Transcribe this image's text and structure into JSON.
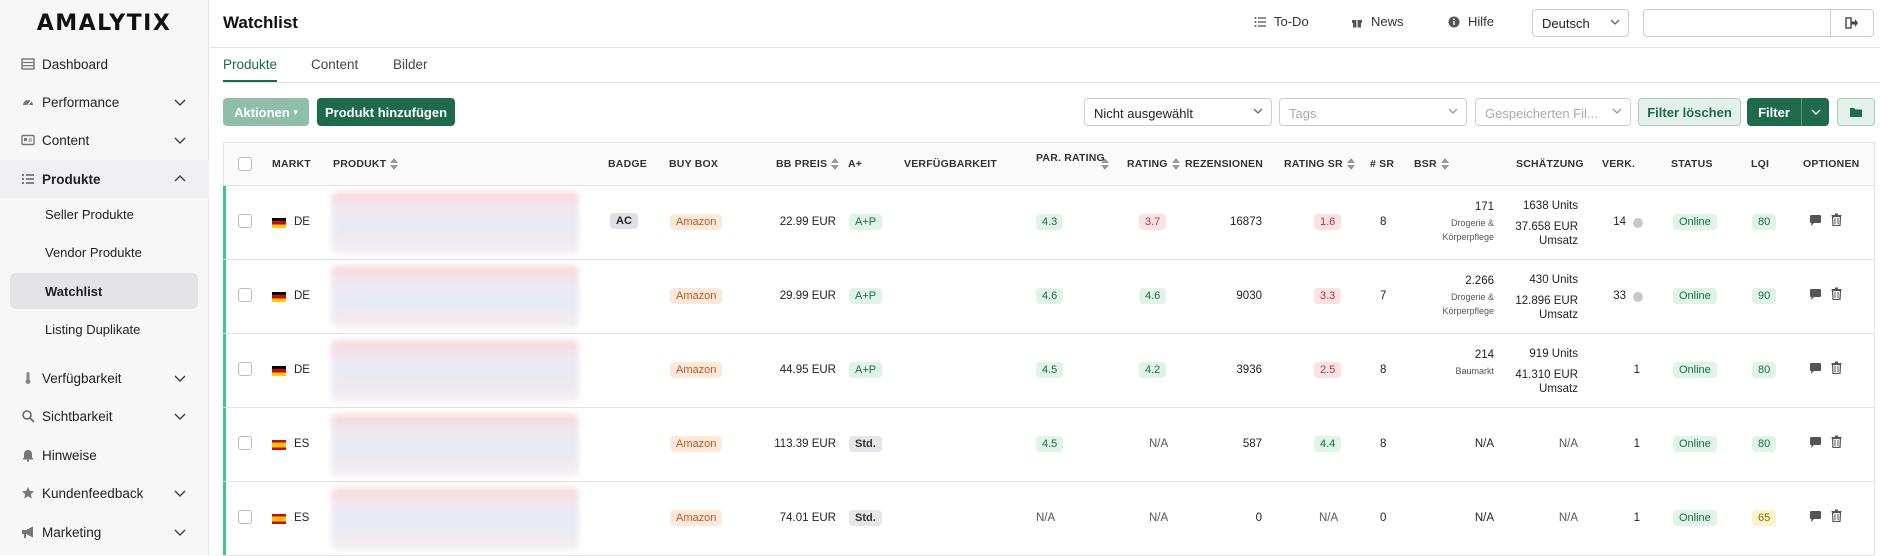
{
  "brand": {
    "logo": "AMALYTIX"
  },
  "sidebar": {
    "items": [
      {
        "label": "Dashboard",
        "icon": "table-icon",
        "chevron": false
      },
      {
        "label": "Performance",
        "icon": "gauge-icon",
        "chevron": true
      },
      {
        "label": "Content",
        "icon": "card-icon",
        "chevron": true
      },
      {
        "label": "Produkte",
        "icon": "list-icon",
        "chevron": true,
        "open": true
      },
      {
        "label": "Verfügbarkeit",
        "icon": "thermometer-icon",
        "chevron": true
      },
      {
        "label": "Sichtbarkeit",
        "icon": "search-icon",
        "chevron": true
      },
      {
        "label": "Hinweise",
        "icon": "bell-icon",
        "chevron": false
      },
      {
        "label": "Kundenfeedback",
        "icon": "star-icon",
        "chevron": true
      },
      {
        "label": "Marketing",
        "icon": "megaphone-icon",
        "chevron": true
      }
    ],
    "subitems": [
      {
        "label": "Seller Produkte",
        "active": false
      },
      {
        "label": "Vendor Produkte",
        "active": false
      },
      {
        "label": "Watchlist",
        "active": true
      },
      {
        "label": "Listing Duplikate",
        "active": false
      }
    ]
  },
  "header": {
    "title": "Watchlist",
    "todo": "To-Do",
    "news": "News",
    "help": "Hilfe",
    "language": "Deutsch",
    "search_value": ""
  },
  "tabs": [
    "Produkte",
    "Content",
    "Bilder"
  ],
  "toolbar": {
    "actions": "Aktionen",
    "add_product": "Produkt hinzufügen",
    "select1": "Nicht ausgewählt",
    "tags_placeholder": "Tags",
    "saved_filters_placeholder": "Gespeicherten Fil...",
    "clear_filter": "Filter löschen",
    "filter": "Filter"
  },
  "table": {
    "columns": [
      "MARKT",
      "PRODUKT",
      "BADGE",
      "BUY BOX",
      "BB PREIS",
      "A+",
      "VERFÜGBARKEIT",
      "PAR. RATING",
      "RATING",
      "REZENSIONEN",
      "RATING SR",
      "# SR",
      "BSR",
      "SCHÄTZUNG",
      "VERK.",
      "STATUS",
      "LQI",
      "OPTIONEN"
    ],
    "rows": [
      {
        "market": "DE",
        "badge": "AC",
        "buybox": "Amazon",
        "price": "22.99 EUR",
        "aplus": "A+P",
        "par_rating": "4.3",
        "rating": "3.7",
        "rating_color": "red",
        "reviews": "16873",
        "rating_sr": "1.6",
        "rating_sr_color": "red",
        "sr": "8",
        "bsr": "171",
        "bsr_cat1": "Drogerie &",
        "bsr_cat2": "Körperpflege",
        "est_units": "1638 Units",
        "est_rev1": "37.658 EUR",
        "est_rev2": "Umsatz",
        "verk": "14",
        "verk_info": true,
        "status": "Online",
        "lqi": "80",
        "lqi_color": "green"
      },
      {
        "market": "DE",
        "badge": "",
        "buybox": "Amazon",
        "price": "29.99 EUR",
        "aplus": "A+P",
        "par_rating": "4.6",
        "rating": "4.6",
        "rating_color": "green",
        "reviews": "9030",
        "rating_sr": "3.3",
        "rating_sr_color": "red",
        "sr": "7",
        "bsr": "2.266",
        "bsr_cat1": "Drogerie &",
        "bsr_cat2": "Körperpflege",
        "est_units": "430 Units",
        "est_rev1": "12.896 EUR",
        "est_rev2": "Umsatz",
        "verk": "33",
        "verk_info": true,
        "status": "Online",
        "lqi": "90",
        "lqi_color": "green"
      },
      {
        "market": "DE",
        "badge": "",
        "buybox": "Amazon",
        "price": "44.95 EUR",
        "aplus": "A+P",
        "par_rating": "4.5",
        "rating": "4.2",
        "rating_color": "green",
        "reviews": "3936",
        "rating_sr": "2.5",
        "rating_sr_color": "red",
        "sr": "8",
        "bsr": "214",
        "bsr_cat1": "Baumarkt",
        "bsr_cat2": "",
        "est_units": "919 Units",
        "est_rev1": "41.310 EUR",
        "est_rev2": "Umsatz",
        "verk": "1",
        "verk_info": false,
        "status": "Online",
        "lqi": "80",
        "lqi_color": "green"
      },
      {
        "market": "ES",
        "badge": "",
        "buybox": "Amazon",
        "price": "113.39 EUR",
        "aplus": "Std.",
        "par_rating": "4.5",
        "rating": "N/A",
        "rating_color": "none",
        "reviews": "587",
        "rating_sr": "4.4",
        "rating_sr_color": "green",
        "sr": "8",
        "bsr": "N/A",
        "bsr_cat1": "",
        "bsr_cat2": "",
        "est_units": "N/A",
        "est_rev1": "",
        "est_rev2": "",
        "verk": "1",
        "verk_info": false,
        "status": "Online",
        "lqi": "80",
        "lqi_color": "green"
      },
      {
        "market": "ES",
        "badge": "",
        "buybox": "Amazon",
        "price": "74.01 EUR",
        "aplus": "Std.",
        "par_rating": "N/A",
        "rating": "N/A",
        "rating_color": "none",
        "reviews": "0",
        "rating_sr": "N/A",
        "rating_sr_color": "none",
        "sr": "0",
        "bsr": "N/A",
        "bsr_cat1": "",
        "bsr_cat2": "",
        "est_units": "N/A",
        "est_rev1": "",
        "est_rev2": "",
        "verk": "1",
        "verk_info": false,
        "status": "Online",
        "lqi": "65",
        "lqi_color": "yellow"
      }
    ]
  }
}
